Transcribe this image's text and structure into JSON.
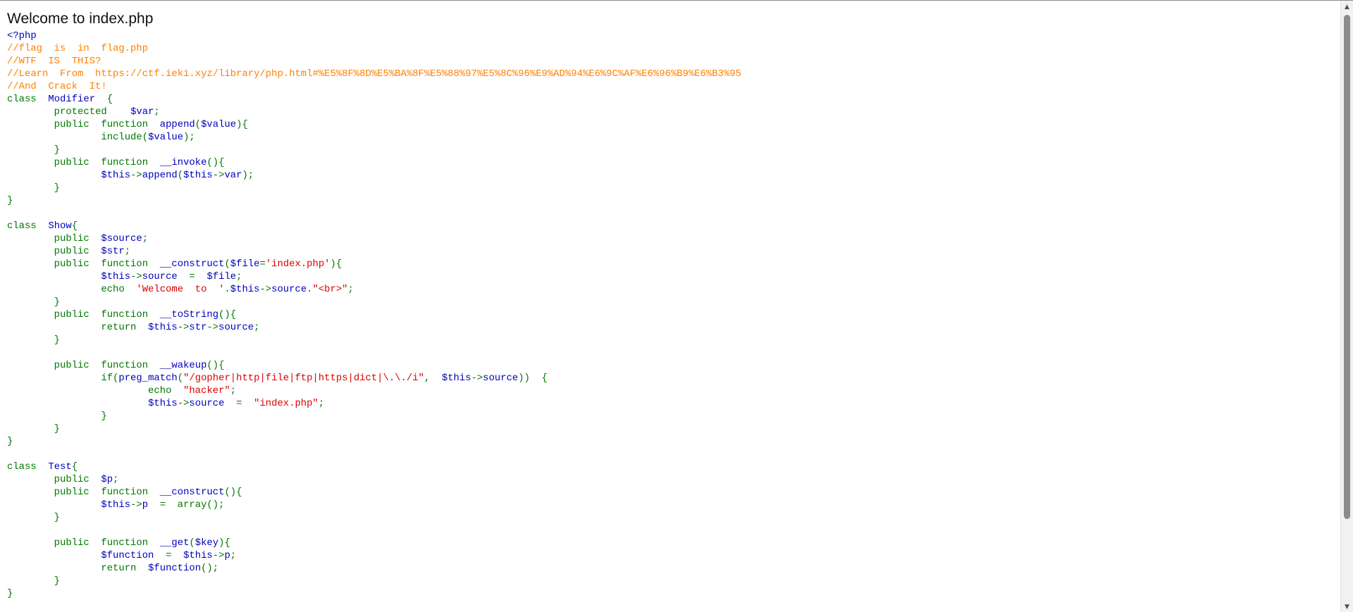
{
  "page": {
    "welcome_text": "Welcome to index.php"
  },
  "code": {
    "lines": [
      [
        {
          "t": "default",
          "s": "<?php"
        }
      ],
      [
        {
          "t": "comment",
          "s": "//flag  is  in  flag.php"
        }
      ],
      [
        {
          "t": "comment",
          "s": "//WTF  IS  THIS?"
        }
      ],
      [
        {
          "t": "comment",
          "s": "//Learn  From  https://ctf.ieki.xyz/library/php.html#%E5%8F%8D%E5%BA%8F%E5%88%97%E5%8C%96%E9%AD%94%E6%9C%AF%E6%96%B9%E6%B3%95"
        }
      ],
      [
        {
          "t": "comment",
          "s": "//And  Crack  It!"
        }
      ],
      [
        {
          "t": "keyword",
          "s": "class  "
        },
        {
          "t": "default",
          "s": "Modifier  "
        },
        {
          "t": "keyword",
          "s": "{"
        }
      ],
      [
        {
          "t": "keyword",
          "s": "        protected    "
        },
        {
          "t": "default",
          "s": "$var"
        },
        {
          "t": "keyword",
          "s": ";"
        }
      ],
      [
        {
          "t": "keyword",
          "s": "        public  function  "
        },
        {
          "t": "default",
          "s": "append"
        },
        {
          "t": "keyword",
          "s": "("
        },
        {
          "t": "default",
          "s": "$value"
        },
        {
          "t": "keyword",
          "s": "){"
        }
      ],
      [
        {
          "t": "keyword",
          "s": "                include("
        },
        {
          "t": "default",
          "s": "$value"
        },
        {
          "t": "keyword",
          "s": ");"
        }
      ],
      [
        {
          "t": "keyword",
          "s": "        }"
        }
      ],
      [
        {
          "t": "keyword",
          "s": "        public  function  "
        },
        {
          "t": "default",
          "s": "__invoke"
        },
        {
          "t": "keyword",
          "s": "(){"
        }
      ],
      [
        {
          "t": "keyword",
          "s": "                "
        },
        {
          "t": "default",
          "s": "$this"
        },
        {
          "t": "keyword",
          "s": "->"
        },
        {
          "t": "default",
          "s": "append"
        },
        {
          "t": "keyword",
          "s": "("
        },
        {
          "t": "default",
          "s": "$this"
        },
        {
          "t": "keyword",
          "s": "->"
        },
        {
          "t": "default",
          "s": "var"
        },
        {
          "t": "keyword",
          "s": ");"
        }
      ],
      [
        {
          "t": "keyword",
          "s": "        }"
        }
      ],
      [
        {
          "t": "keyword",
          "s": "}"
        }
      ],
      [
        {
          "t": "keyword",
          "s": ""
        }
      ],
      [
        {
          "t": "keyword",
          "s": "class  "
        },
        {
          "t": "default",
          "s": "Show"
        },
        {
          "t": "keyword",
          "s": "{"
        }
      ],
      [
        {
          "t": "keyword",
          "s": "        public  "
        },
        {
          "t": "default",
          "s": "$source"
        },
        {
          "t": "keyword",
          "s": ";"
        }
      ],
      [
        {
          "t": "keyword",
          "s": "        public  "
        },
        {
          "t": "default",
          "s": "$str"
        },
        {
          "t": "keyword",
          "s": ";"
        }
      ],
      [
        {
          "t": "keyword",
          "s": "        public  function  "
        },
        {
          "t": "default",
          "s": "__construct"
        },
        {
          "t": "keyword",
          "s": "("
        },
        {
          "t": "default",
          "s": "$file"
        },
        {
          "t": "keyword",
          "s": "="
        },
        {
          "t": "string",
          "s": "'index.php'"
        },
        {
          "t": "keyword",
          "s": "){"
        }
      ],
      [
        {
          "t": "keyword",
          "s": "                "
        },
        {
          "t": "default",
          "s": "$this"
        },
        {
          "t": "keyword",
          "s": "->"
        },
        {
          "t": "default",
          "s": "source  "
        },
        {
          "t": "keyword",
          "s": "=  "
        },
        {
          "t": "default",
          "s": "$file"
        },
        {
          "t": "keyword",
          "s": ";"
        }
      ],
      [
        {
          "t": "keyword",
          "s": "                echo  "
        },
        {
          "t": "string",
          "s": "'Welcome  to  '"
        },
        {
          "t": "keyword",
          "s": "."
        },
        {
          "t": "default",
          "s": "$this"
        },
        {
          "t": "keyword",
          "s": "->"
        },
        {
          "t": "default",
          "s": "source"
        },
        {
          "t": "keyword",
          "s": "."
        },
        {
          "t": "string",
          "s": "\"<br>\""
        },
        {
          "t": "keyword",
          "s": ";"
        }
      ],
      [
        {
          "t": "keyword",
          "s": "        }"
        }
      ],
      [
        {
          "t": "keyword",
          "s": "        public  function  "
        },
        {
          "t": "default",
          "s": "__toString"
        },
        {
          "t": "keyword",
          "s": "(){"
        }
      ],
      [
        {
          "t": "keyword",
          "s": "                return  "
        },
        {
          "t": "default",
          "s": "$this"
        },
        {
          "t": "keyword",
          "s": "->"
        },
        {
          "t": "default",
          "s": "str"
        },
        {
          "t": "keyword",
          "s": "->"
        },
        {
          "t": "default",
          "s": "source"
        },
        {
          "t": "keyword",
          "s": ";"
        }
      ],
      [
        {
          "t": "keyword",
          "s": "        }"
        }
      ],
      [
        {
          "t": "keyword",
          "s": ""
        }
      ],
      [
        {
          "t": "keyword",
          "s": "        public  function  "
        },
        {
          "t": "default",
          "s": "__wakeup"
        },
        {
          "t": "keyword",
          "s": "(){"
        }
      ],
      [
        {
          "t": "keyword",
          "s": "                if("
        },
        {
          "t": "default",
          "s": "preg_match"
        },
        {
          "t": "keyword",
          "s": "("
        },
        {
          "t": "string",
          "s": "\"/gopher|http|file|ftp|https|dict|\\.\\./i\""
        },
        {
          "t": "keyword",
          "s": ",  "
        },
        {
          "t": "default",
          "s": "$this"
        },
        {
          "t": "keyword",
          "s": "->"
        },
        {
          "t": "default",
          "s": "source"
        },
        {
          "t": "keyword",
          "s": "))  {"
        }
      ],
      [
        {
          "t": "keyword",
          "s": "                        echo  "
        },
        {
          "t": "string",
          "s": "\"hacker\""
        },
        {
          "t": "keyword",
          "s": ";"
        }
      ],
      [
        {
          "t": "keyword",
          "s": "                        "
        },
        {
          "t": "default",
          "s": "$this"
        },
        {
          "t": "keyword",
          "s": "->"
        },
        {
          "t": "default",
          "s": "source  "
        },
        {
          "t": "keyword",
          "s": "=  "
        },
        {
          "t": "string",
          "s": "\"index.php\""
        },
        {
          "t": "keyword",
          "s": ";"
        }
      ],
      [
        {
          "t": "keyword",
          "s": "                }"
        }
      ],
      [
        {
          "t": "keyword",
          "s": "        }"
        }
      ],
      [
        {
          "t": "keyword",
          "s": "}"
        }
      ],
      [
        {
          "t": "keyword",
          "s": ""
        }
      ],
      [
        {
          "t": "keyword",
          "s": "class  "
        },
        {
          "t": "default",
          "s": "Test"
        },
        {
          "t": "keyword",
          "s": "{"
        }
      ],
      [
        {
          "t": "keyword",
          "s": "        public  "
        },
        {
          "t": "default",
          "s": "$p"
        },
        {
          "t": "keyword",
          "s": ";"
        }
      ],
      [
        {
          "t": "keyword",
          "s": "        public  function  "
        },
        {
          "t": "default",
          "s": "__construct"
        },
        {
          "t": "keyword",
          "s": "(){"
        }
      ],
      [
        {
          "t": "keyword",
          "s": "                "
        },
        {
          "t": "default",
          "s": "$this"
        },
        {
          "t": "keyword",
          "s": "->"
        },
        {
          "t": "default",
          "s": "p  "
        },
        {
          "t": "keyword",
          "s": "=  array();"
        }
      ],
      [
        {
          "t": "keyword",
          "s": "        }"
        }
      ],
      [
        {
          "t": "keyword",
          "s": ""
        }
      ],
      [
        {
          "t": "keyword",
          "s": "        public  function  "
        },
        {
          "t": "default",
          "s": "__get"
        },
        {
          "t": "keyword",
          "s": "("
        },
        {
          "t": "default",
          "s": "$key"
        },
        {
          "t": "keyword",
          "s": "){"
        }
      ],
      [
        {
          "t": "keyword",
          "s": "                "
        },
        {
          "t": "default",
          "s": "$function  "
        },
        {
          "t": "keyword",
          "s": "=  "
        },
        {
          "t": "default",
          "s": "$this"
        },
        {
          "t": "keyword",
          "s": "->"
        },
        {
          "t": "default",
          "s": "p"
        },
        {
          "t": "keyword",
          "s": ";"
        }
      ],
      [
        {
          "t": "keyword",
          "s": "                return  "
        },
        {
          "t": "default",
          "s": "$function"
        },
        {
          "t": "keyword",
          "s": "();"
        }
      ],
      [
        {
          "t": "keyword",
          "s": "        }"
        }
      ],
      [
        {
          "t": "keyword",
          "s": "}"
        }
      ]
    ]
  },
  "colors": {
    "default": "#0000BB",
    "keyword": "#007700",
    "string": "#DD0000",
    "comment": "#FF8000"
  },
  "scrollbar": {
    "up_icon": "triangle-up-icon",
    "down_icon": "triangle-down-icon",
    "up_glyph": "▲",
    "down_glyph": "▼"
  }
}
